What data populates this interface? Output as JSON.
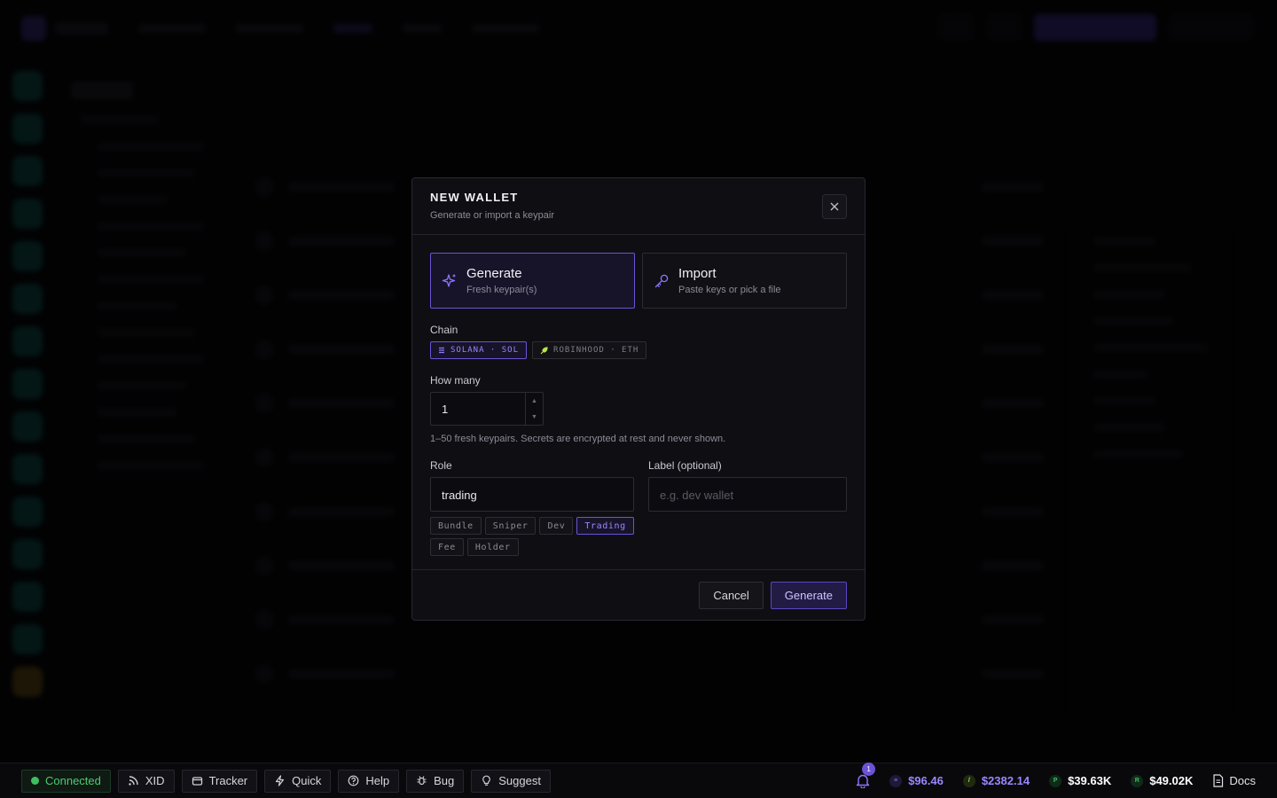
{
  "modal": {
    "title": "NEW WALLET",
    "subtitle": "Generate or import a keypair",
    "modes": [
      {
        "title": "Generate",
        "desc": "Fresh keypair(s)"
      },
      {
        "title": "Import",
        "desc": "Paste keys or pick a file"
      }
    ],
    "active_mode": "Generate",
    "chain_label": "Chain",
    "chains": [
      {
        "name": "SOLANA",
        "symbol": "SOL",
        "display": "SOLANA · SOL"
      },
      {
        "name": "ROBINHOOD",
        "symbol": "ETH",
        "display": "ROBINHOOD · ETH"
      }
    ],
    "active_chain": "SOLANA",
    "count_label": "How many",
    "count_value": "1",
    "count_hint": "1–50 fresh keypairs. Secrets are encrypted at rest and never shown.",
    "role_label": "Role",
    "role_value": "trading",
    "roles": [
      "Bundle",
      "Sniper",
      "Dev",
      "Trading",
      "Fee",
      "Holder"
    ],
    "active_role": "Trading",
    "label_label": "Label (optional)",
    "label_placeholder": "e.g. dev wallet",
    "cancel_label": "Cancel",
    "submit_label": "Generate"
  },
  "statusbar": {
    "connected": "Connected",
    "buttons": [
      "XID",
      "Tracker",
      "Quick",
      "Help",
      "Bug",
      "Suggest"
    ],
    "notification_count": "1",
    "prices": [
      {
        "value": "$96.46",
        "color": "#9c86ff"
      },
      {
        "value": "$2382.14",
        "color": "#9c86ff"
      },
      {
        "value": "$39.63K",
        "color": "#ffffff"
      },
      {
        "value": "$49.02K",
        "color": "#ffffff"
      }
    ],
    "docs": "Docs"
  },
  "colors": {
    "accent": "#6c52d6",
    "connected": "#3fbf62"
  }
}
